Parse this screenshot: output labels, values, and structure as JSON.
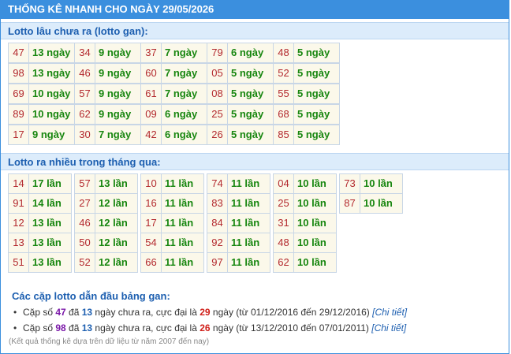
{
  "title": "THỐNG KÊ NHANH CHO NGÀY 29/05/2026",
  "gan": {
    "heading": "Lotto lâu chưa ra (lotto gan):",
    "columns": [
      [
        [
          "47",
          "13 ngày"
        ],
        [
          "98",
          "13 ngày"
        ],
        [
          "69",
          "10 ngày"
        ],
        [
          "89",
          "10 ngày"
        ],
        [
          "17",
          "9 ngày"
        ]
      ],
      [
        [
          "34",
          "9 ngày"
        ],
        [
          "46",
          "9 ngày"
        ],
        [
          "57",
          "9 ngày"
        ],
        [
          "62",
          "9 ngày"
        ],
        [
          "30",
          "7 ngày"
        ]
      ],
      [
        [
          "37",
          "7 ngày"
        ],
        [
          "60",
          "7 ngày"
        ],
        [
          "61",
          "7 ngày"
        ],
        [
          "09",
          "6 ngày"
        ],
        [
          "42",
          "6 ngày"
        ]
      ],
      [
        [
          "79",
          "6 ngày"
        ],
        [
          "05",
          "5 ngày"
        ],
        [
          "08",
          "5 ngày"
        ],
        [
          "25",
          "5 ngày"
        ],
        [
          "26",
          "5 ngày"
        ]
      ],
      [
        [
          "48",
          "5 ngày"
        ],
        [
          "52",
          "5 ngày"
        ],
        [
          "55",
          "5 ngày"
        ],
        [
          "68",
          "5 ngày"
        ],
        [
          "85",
          "5 ngày"
        ]
      ]
    ]
  },
  "nhieu": {
    "heading": "Lotto ra nhiều trong tháng qua:",
    "columns": [
      [
        [
          "14",
          "17 lần"
        ],
        [
          "91",
          "14 lần"
        ],
        [
          "12",
          "13 lần"
        ],
        [
          "13",
          "13 lần"
        ],
        [
          "51",
          "13 lần"
        ]
      ],
      [
        [
          "57",
          "13 lần"
        ],
        [
          "27",
          "12 lần"
        ],
        [
          "46",
          "12 lần"
        ],
        [
          "50",
          "12 lần"
        ],
        [
          "52",
          "12 lần"
        ]
      ],
      [
        [
          "10",
          "11 lần"
        ],
        [
          "16",
          "11 lần"
        ],
        [
          "17",
          "11 lần"
        ],
        [
          "54",
          "11 lần"
        ],
        [
          "66",
          "11 lần"
        ]
      ],
      [
        [
          "74",
          "11 lần"
        ],
        [
          "83",
          "11 lần"
        ],
        [
          "84",
          "11 lần"
        ],
        [
          "92",
          "11 lần"
        ],
        [
          "97",
          "11 lần"
        ]
      ],
      [
        [
          "04",
          "10 lần"
        ],
        [
          "25",
          "10 lần"
        ],
        [
          "31",
          "10 lần"
        ],
        [
          "48",
          "10 lần"
        ],
        [
          "62",
          "10 lần"
        ]
      ],
      [
        [
          "73",
          "10 lần"
        ],
        [
          "87",
          "10 lần"
        ]
      ]
    ]
  },
  "summary": {
    "heading": "Các cặp lotto dẫn đầu bảng gan:",
    "pairs": [
      {
        "prefix": "Cặp số ",
        "num": "47",
        "mid1": " đã ",
        "days": "13",
        "mid2": " ngày chưa ra, cực đại là ",
        "max": "29",
        "mid3": " ngày (từ 01/12/2016 đến 29/12/2016) ",
        "link": "[Chi tiết]"
      },
      {
        "prefix": "Cặp số ",
        "num": "98",
        "mid1": " đã ",
        "days": "13",
        "mid2": " ngày chưa ra, cực đại là ",
        "max": "26",
        "mid3": " ngày (từ 13/12/2010 đến 07/01/2011) ",
        "link": "[Chi tiết]"
      }
    ],
    "note": "(Kết quả thống kê dựa trên dữ liệu từ năm 2007 đến nay)"
  }
}
